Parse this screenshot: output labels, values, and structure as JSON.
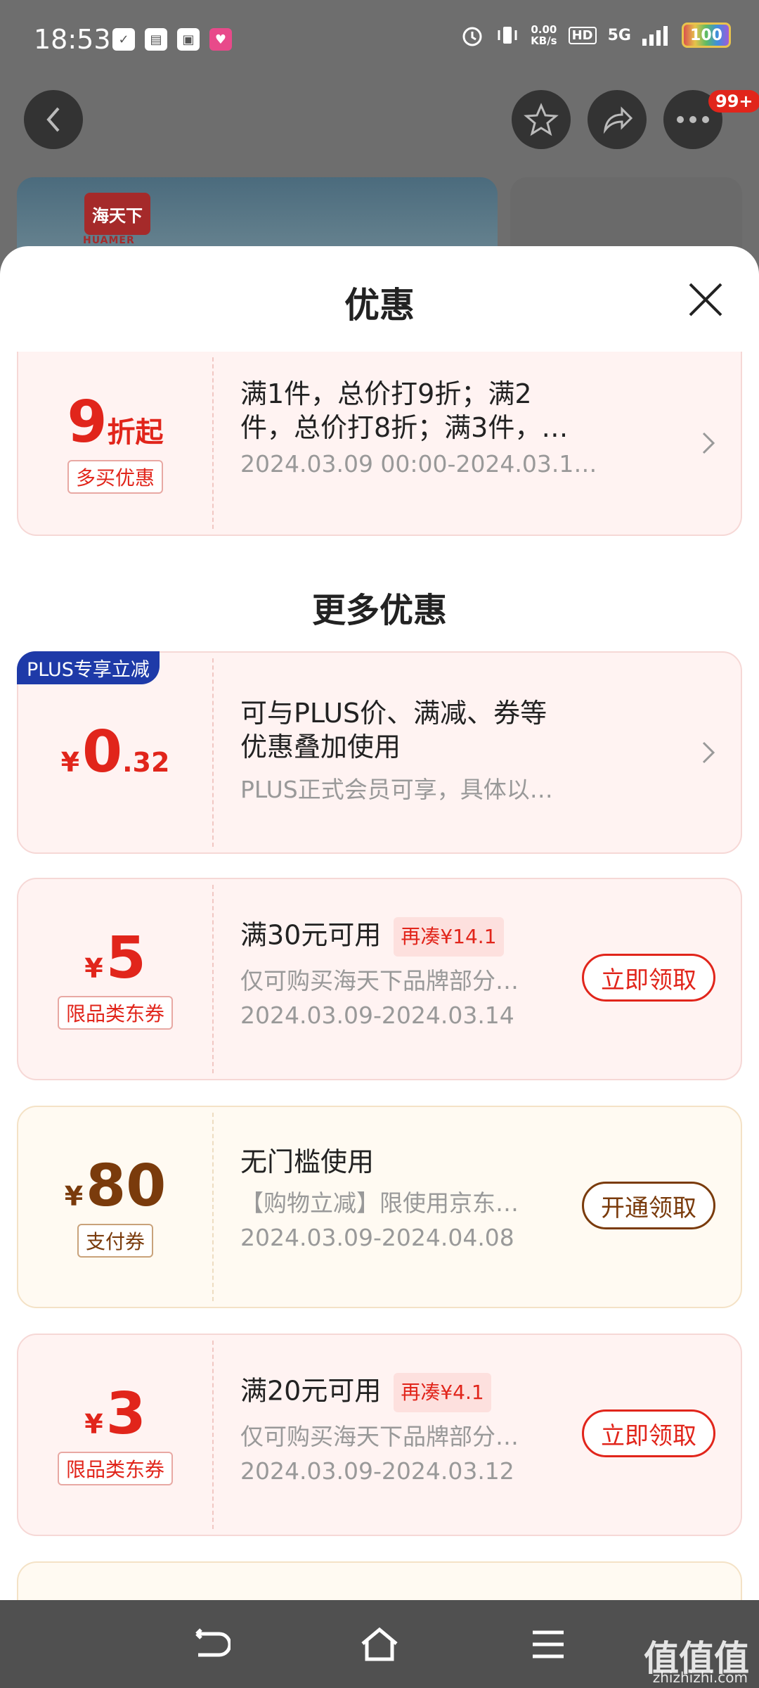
{
  "status_bar": {
    "time": "18:53",
    "netspeed_value": "0.00",
    "netspeed_unit": "KB/s",
    "hd": "HD",
    "network": "5G",
    "battery": "100"
  },
  "header": {
    "cart_badge": "99+",
    "brand_name": "海天下",
    "brand_en": "HUAMER"
  },
  "sheet": {
    "title": "优惠",
    "more_title": "更多优惠"
  },
  "coupons": [
    {
      "amount_big": "9",
      "amount_unit": "折起",
      "tag": "多买优惠",
      "line1": "满1件，总价打9折；满2",
      "line2": "件，总价打8折；满3件，…",
      "sub": "2024.03.09 00:00-2024.03.1…"
    },
    {
      "badge": "PLUS专享立减",
      "yen": "¥",
      "amount_big": "0",
      "amount_small": ".32",
      "line1": "可与PLUS价、满减、券等",
      "line2": "优惠叠加使用",
      "sub": "PLUS正式会员可享，具体以…"
    },
    {
      "yen": "¥",
      "amount_big": "5",
      "tag": "限品类东券",
      "title": "满30元可用",
      "pill": "再凑¥14.1",
      "sub": "仅可购买海天下品牌部分…",
      "date": "2024.03.09-2024.03.14",
      "action": "立即领取"
    },
    {
      "yen": "¥",
      "amount_big": "80",
      "tag": "支付券",
      "title": "无门槛使用",
      "sub": "【购物立减】限使用京东…",
      "date": "2024.03.09-2024.04.08",
      "action": "开通领取"
    },
    {
      "yen": "¥",
      "amount_big": "3",
      "tag": "限品类东券",
      "title": "满20元可用",
      "pill": "再凑¥4.1",
      "sub": "仅可购买海天下品牌部分…",
      "date": "2024.03.09-2024.03.12",
      "action": "立即领取"
    }
  ],
  "watermark": {
    "main": "值值值",
    "sub": "zhizhizhi.com"
  },
  "colors": {
    "accent": "#e1251b",
    "gold": "#7a3b0c",
    "plus_blue": "#1e3aa8"
  }
}
